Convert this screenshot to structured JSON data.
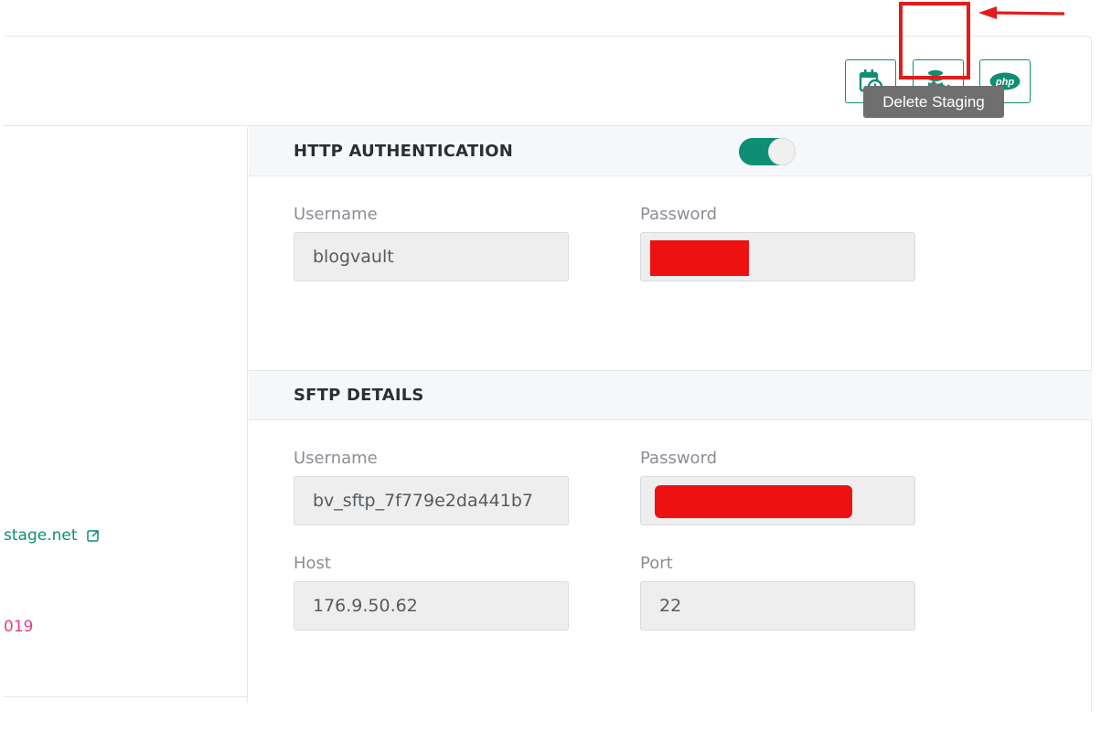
{
  "toolbar": {
    "buttons": [
      {
        "icon": "calendar-clock-icon"
      },
      {
        "icon": "database-delete-icon"
      },
      {
        "icon": "php-icon",
        "label": "php"
      }
    ],
    "tooltip": "Delete Staging",
    "accent_color": "#0e8f74",
    "highlight_color": "#e21b1b"
  },
  "left": {
    "stage_link": "stage.net",
    "date_fragment": "019"
  },
  "http_auth": {
    "title": "HTTP AUTHENTICATION",
    "enabled": true,
    "username_label": "Username",
    "username_value": "blogvault",
    "password_label": "Password"
  },
  "sftp": {
    "title": "SFTP DETAILS",
    "username_label": "Username",
    "username_value": "bv_sftp_7f779e2da441b7",
    "password_label": "Password",
    "host_label": "Host",
    "host_value": "176.9.50.62",
    "port_label": "Port",
    "port_value": "22"
  }
}
